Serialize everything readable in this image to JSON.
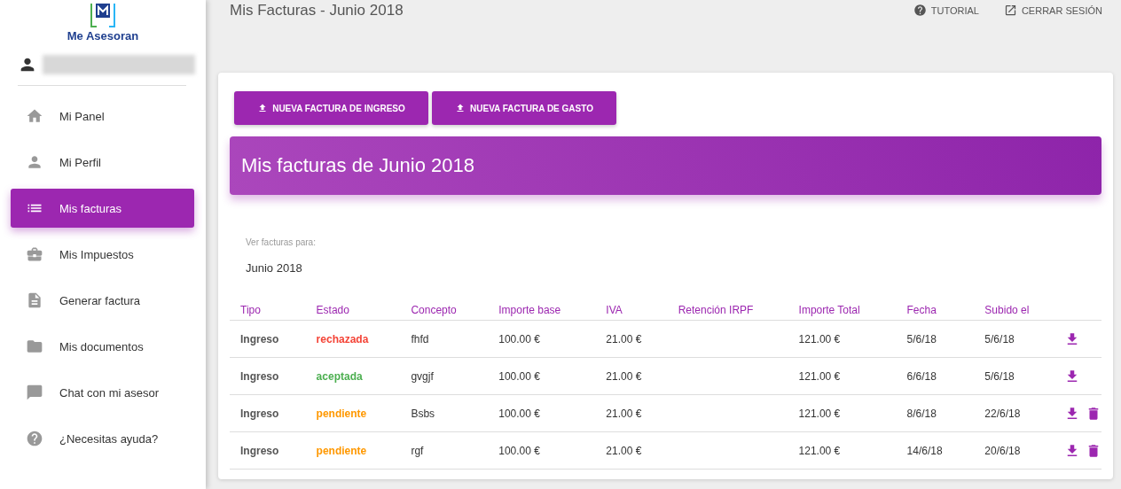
{
  "sidebar": {
    "logo_text": "Me Asesoran",
    "items": [
      {
        "label": "Mi Panel",
        "selected": false
      },
      {
        "label": "Mi Perfil",
        "selected": false
      },
      {
        "label": "Mis facturas",
        "selected": true
      },
      {
        "label": "Mis Impuestos",
        "selected": false
      },
      {
        "label": "Generar factura",
        "selected": false
      },
      {
        "label": "Mis documentos",
        "selected": false
      },
      {
        "label": "Chat con mi asesor",
        "selected": false
      },
      {
        "label": "¿Necesitas ayuda?",
        "selected": false
      }
    ]
  },
  "header": {
    "title": "Mis Facturas - Junio 2018",
    "actions": [
      "TUTORIAL",
      "CERRAR SESIÓN"
    ]
  },
  "buttons": [
    "NUEVA FACTURA DE INGRESO",
    "NUEVA FACTURA DE GASTO"
  ],
  "banner": {
    "title": "Mis facturas de Junio 2018"
  },
  "period": {
    "label": "Ver facturas para:",
    "value": "Junio 2018"
  },
  "table": {
    "columns": [
      "Tipo",
      "Estado",
      "Concepto",
      "Importe base",
      "IVA",
      "Retención IRPF",
      "Importe Total",
      "Fecha",
      "Subido el"
    ],
    "rows": [
      {
        "tipo": "Ingreso",
        "estado": "rechazada",
        "color": "#f44336",
        "concepto": "fhfd",
        "base": "100.00 €",
        "iva": "21.00 €",
        "total": "121.00 €",
        "fecha": "5/6/18",
        "subido": "5/6/18",
        "deletable": false
      },
      {
        "tipo": "Ingreso",
        "estado": "aceptada",
        "color": "#4caf50",
        "concepto": "gvgjf",
        "base": "100.00 €",
        "iva": "21.00 €",
        "total": "121.00 €",
        "fecha": "6/6/18",
        "subido": "5/6/18",
        "deletable": false
      },
      {
        "tipo": "Ingreso",
        "estado": "pendiente",
        "color": "#ff9800",
        "concepto": "Bsbs",
        "base": "100.00 €",
        "iva": "21.00 €",
        "total": "121.00 €",
        "fecha": "8/6/18",
        "subido": "22/6/18",
        "deletable": true
      },
      {
        "tipo": "Ingreso",
        "estado": "pendiente",
        "color": "#ff9800",
        "concepto": "rgf",
        "base": "100.00 €",
        "iva": "21.00 €",
        "total": "121.00 €",
        "fecha": "14/6/18",
        "subido": "20/6/18",
        "deletable": true
      }
    ]
  }
}
